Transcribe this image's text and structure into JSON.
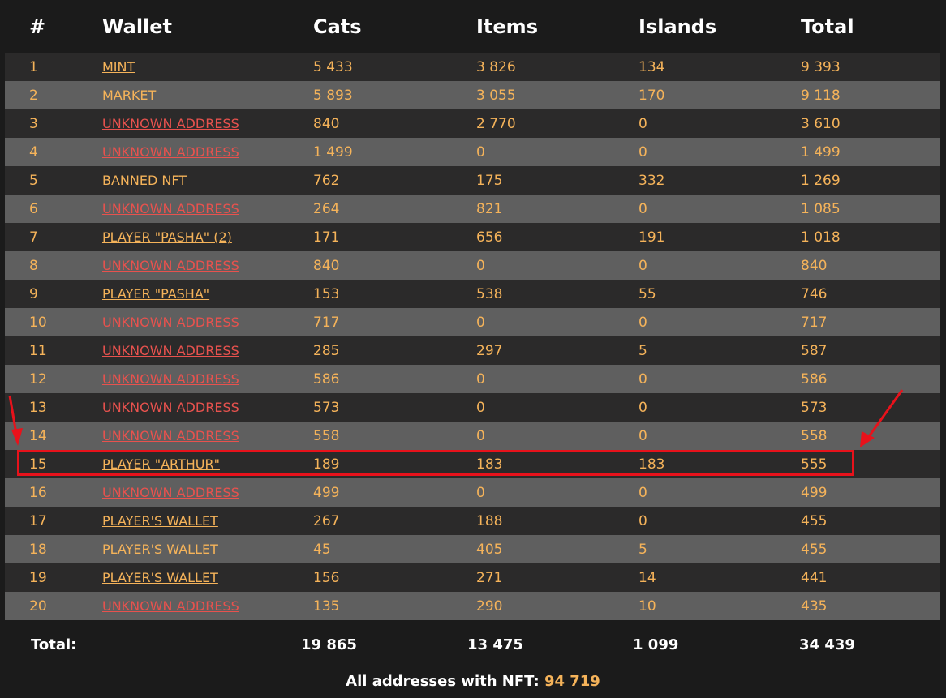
{
  "header": {
    "num": "#",
    "wallet": "Wallet",
    "cats": "Cats",
    "items": "Items",
    "islands": "Islands",
    "total": "Total"
  },
  "rows": [
    {
      "num": "1",
      "wallet": "MINT",
      "known": true,
      "cats": "5 433",
      "items": "3 826",
      "islands": "134",
      "total": "9 393"
    },
    {
      "num": "2",
      "wallet": "MARKET",
      "known": true,
      "cats": "5 893",
      "items": "3 055",
      "islands": "170",
      "total": "9 118"
    },
    {
      "num": "3",
      "wallet": "UNKNOWN ADDRESS",
      "known": false,
      "cats": "840",
      "items": "2 770",
      "islands": "0",
      "total": "3 610"
    },
    {
      "num": "4",
      "wallet": "UNKNOWN ADDRESS",
      "known": false,
      "cats": "1 499",
      "items": "0",
      "islands": "0",
      "total": "1 499"
    },
    {
      "num": "5",
      "wallet": "BANNED NFT",
      "known": true,
      "cats": "762",
      "items": "175",
      "islands": "332",
      "total": "1 269"
    },
    {
      "num": "6",
      "wallet": "UNKNOWN ADDRESS",
      "known": false,
      "cats": "264",
      "items": "821",
      "islands": "0",
      "total": "1 085"
    },
    {
      "num": "7",
      "wallet": "PLAYER \"PASHA\" (2)",
      "known": true,
      "cats": "171",
      "items": "656",
      "islands": "191",
      "total": "1 018"
    },
    {
      "num": "8",
      "wallet": "UNKNOWN ADDRESS",
      "known": false,
      "cats": "840",
      "items": "0",
      "islands": "0",
      "total": "840"
    },
    {
      "num": "9",
      "wallet": "PLAYER \"PASHA\"",
      "known": true,
      "cats": "153",
      "items": "538",
      "islands": "55",
      "total": "746"
    },
    {
      "num": "10",
      "wallet": "UNKNOWN ADDRESS",
      "known": false,
      "cats": "717",
      "items": "0",
      "islands": "0",
      "total": "717"
    },
    {
      "num": "11",
      "wallet": "UNKNOWN ADDRESS",
      "known": false,
      "cats": "285",
      "items": "297",
      "islands": "5",
      "total": "587"
    },
    {
      "num": "12",
      "wallet": "UNKNOWN ADDRESS",
      "known": false,
      "cats": "586",
      "items": "0",
      "islands": "0",
      "total": "586"
    },
    {
      "num": "13",
      "wallet": "UNKNOWN ADDRESS",
      "known": false,
      "cats": "573",
      "items": "0",
      "islands": "0",
      "total": "573"
    },
    {
      "num": "14",
      "wallet": "UNKNOWN ADDRESS",
      "known": false,
      "cats": "558",
      "items": "0",
      "islands": "0",
      "total": "558"
    },
    {
      "num": "15",
      "wallet": "PLAYER \"ARTHUR\"",
      "known": true,
      "cats": "189",
      "items": "183",
      "islands": "183",
      "total": "555"
    },
    {
      "num": "16",
      "wallet": "UNKNOWN ADDRESS",
      "known": false,
      "cats": "499",
      "items": "0",
      "islands": "0",
      "total": "499"
    },
    {
      "num": "17",
      "wallet": "PLAYER'S WALLET",
      "known": true,
      "cats": "267",
      "items": "188",
      "islands": "0",
      "total": "455"
    },
    {
      "num": "18",
      "wallet": "PLAYER'S WALLET",
      "known": true,
      "cats": "45",
      "items": "405",
      "islands": "5",
      "total": "455"
    },
    {
      "num": "19",
      "wallet": "PLAYER'S WALLET",
      "known": true,
      "cats": "156",
      "items": "271",
      "islands": "14",
      "total": "441"
    },
    {
      "num": "20",
      "wallet": "UNKNOWN ADDRESS",
      "known": false,
      "cats": "135",
      "items": "290",
      "islands": "10",
      "total": "435"
    }
  ],
  "totals": {
    "label": "Total:",
    "cats": "19 865",
    "items": "13 475",
    "islands": "1 099",
    "total": "34 439"
  },
  "footer": {
    "label": "All addresses with NFT:",
    "value": "94 719"
  },
  "colors": {
    "background": "#1b1b1b",
    "row_dark": "#2b2a2a",
    "row_light": "#5f5f5f",
    "accent": "#f5b35a",
    "unknown": "#e8524e",
    "highlight": "#e8121b"
  },
  "highlight": {
    "row_num": "15"
  }
}
